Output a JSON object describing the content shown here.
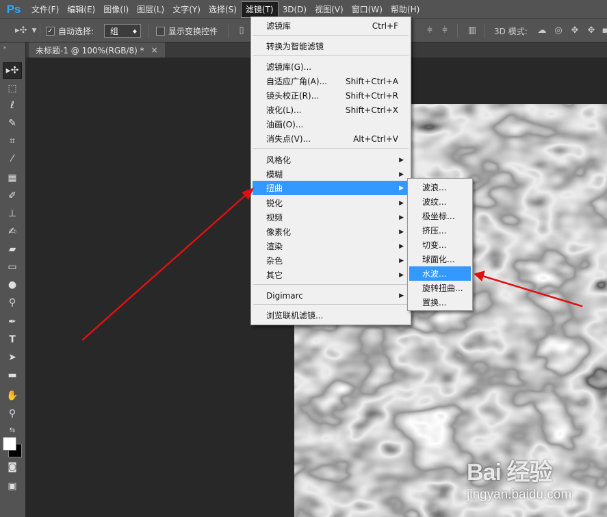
{
  "app": {
    "logo": "Ps",
    "menus": [
      "文件(F)",
      "编辑(E)",
      "图像(I)",
      "图层(L)",
      "文字(Y)",
      "选择(S)",
      "滤镜(T)",
      "3D(D)",
      "视图(V)",
      "窗口(W)",
      "帮助(H)"
    ],
    "active_menu_index": 6
  },
  "options_bar": {
    "auto_select_label": "自动选择:",
    "auto_select_checked": true,
    "auto_select_value": "组",
    "show_transform_label": "显示变换控件",
    "show_transform_checked": false,
    "mode_3d_label": "3D 模式:"
  },
  "document": {
    "tab_title": "未标题-1 @ 100%(RGB/8) *",
    "close_symbol": "×"
  },
  "filter_menu": {
    "items": {
      "filter_gallery_last": {
        "label": "滤镜库",
        "shortcut": "Ctrl+F"
      },
      "convert_smart": {
        "label": "转换为智能滤镜"
      },
      "filter_gallery": {
        "label": "滤镜库(G)..."
      },
      "adaptive_wide_angle": {
        "label": "自适应广角(A)...",
        "shortcut": "Shift+Ctrl+A"
      },
      "lens_correction": {
        "label": "镜头校正(R)...",
        "shortcut": "Shift+Ctrl+R"
      },
      "liquify": {
        "label": "液化(L)...",
        "shortcut": "Shift+Ctrl+X"
      },
      "oil_paint": {
        "label": "油画(O)..."
      },
      "vanishing_point": {
        "label": "消失点(V)...",
        "shortcut": "Alt+Ctrl+V"
      },
      "stylize": {
        "label": "风格化"
      },
      "blur": {
        "label": "模糊"
      },
      "distort": {
        "label": "扭曲"
      },
      "sharpen": {
        "label": "锐化"
      },
      "video": {
        "label": "视频"
      },
      "pixelate": {
        "label": "像素化"
      },
      "render": {
        "label": "渲染"
      },
      "noise": {
        "label": "杂色"
      },
      "other": {
        "label": "其它"
      },
      "digimarc": {
        "label": "Digimarc"
      },
      "browse_online": {
        "label": "浏览联机滤镜..."
      }
    },
    "highlighted": "distort"
  },
  "distort_submenu": {
    "items": [
      "波浪...",
      "波纹...",
      "极坐标...",
      "挤压...",
      "切变...",
      "球面化...",
      "水波...",
      "旋转扭曲...",
      "置换..."
    ],
    "highlighted_index": 6
  },
  "watermark": {
    "logo_text": "Bai 经验",
    "url": "jingyan.baidu.com"
  },
  "colors": {
    "accent": "#3399ff",
    "annotation_arrow": "#e01010",
    "panel": "#535353",
    "workspace": "#282828"
  }
}
